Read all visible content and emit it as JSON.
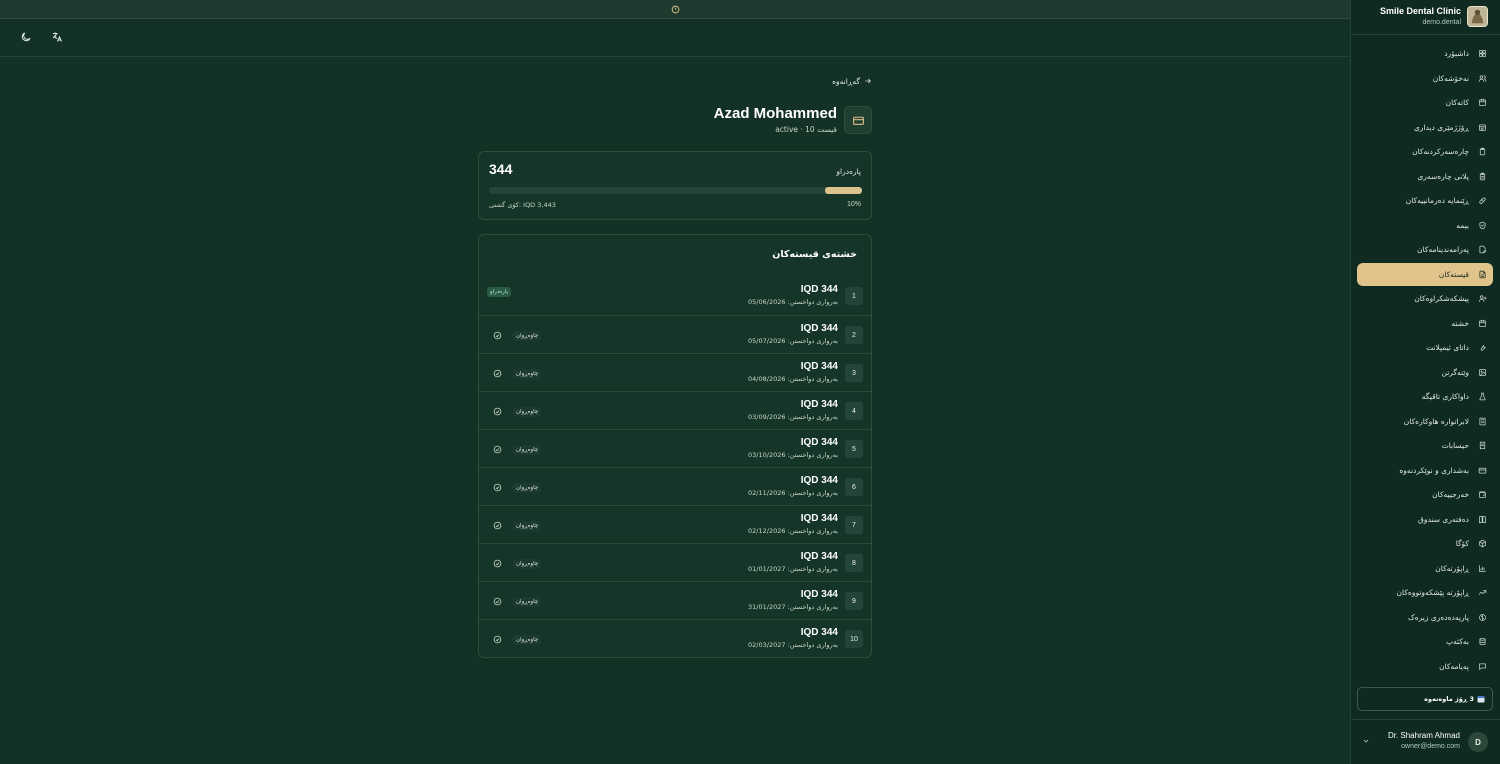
{
  "clinic": {
    "name": "Smile Dental Clinic",
    "domain": "demo.dental"
  },
  "nav": [
    {
      "label": "داشبۆرد",
      "icon": "dashboard-icon",
      "active": false
    },
    {
      "label": "نەخۆشەکان",
      "icon": "users-icon",
      "active": false
    },
    {
      "label": "کاتەکان",
      "icon": "calendar-icon",
      "active": false
    },
    {
      "label": "ڕۆژژمێری دیداری",
      "icon": "calendar-grid-icon",
      "active": false
    },
    {
      "label": "چارەسەرکردنەکان",
      "icon": "clipboard-icon",
      "active": false
    },
    {
      "label": "پلانی چارەسەری",
      "icon": "clipboard-list-icon",
      "active": false
    },
    {
      "label": "ڕێنمایە دەرمانییەکان",
      "icon": "pill-icon",
      "active": false
    },
    {
      "label": "بیمە",
      "icon": "shield-icon",
      "active": false
    },
    {
      "label": "پەزامەندینامەکان",
      "icon": "file-edit-icon",
      "active": false
    },
    {
      "label": "قیستەکان",
      "icon": "file-text-icon",
      "active": true
    },
    {
      "label": "پیشکەشکراوەکان",
      "icon": "user-plus-icon",
      "active": false
    },
    {
      "label": "خشتە",
      "icon": "calendar-icon",
      "active": false
    },
    {
      "label": "داتای ئیمپلانت",
      "icon": "wrench-icon",
      "active": false
    },
    {
      "label": "وێنەگرتن",
      "icon": "image-icon",
      "active": false
    },
    {
      "label": "داواکاری تاقیگە",
      "icon": "flask-icon",
      "active": false
    },
    {
      "label": "لابراتوارە هاوکارەکان",
      "icon": "building-icon",
      "active": false
    },
    {
      "label": "حیسابات",
      "icon": "receipt-icon",
      "active": false
    },
    {
      "label": "بەشداری و نوێکردنەوە",
      "icon": "credit-card-icon",
      "active": false
    },
    {
      "label": "خەرجییەکان",
      "icon": "wallet-icon",
      "active": false
    },
    {
      "label": "دەفتەری سندوق",
      "icon": "book-icon",
      "active": false
    },
    {
      "label": "کۆگا",
      "icon": "box-icon",
      "active": false
    },
    {
      "label": "ڕاپۆرتەکان",
      "icon": "bar-chart-icon",
      "active": false
    },
    {
      "label": "ڕاپۆرتە پێشکەوتووەکان",
      "icon": "trending-up-icon",
      "active": false
    },
    {
      "label": "پاریەدەدەری زیرەک",
      "icon": "brain-icon",
      "active": false
    },
    {
      "label": "بەکئەپ",
      "icon": "database-icon",
      "active": false
    },
    {
      "label": "پەیامەکان",
      "icon": "message-icon",
      "active": false
    }
  ],
  "trial": {
    "text": "3 ڕۆژ ماوەتەوە",
    "icon": "calendar-emoji-icon"
  },
  "user": {
    "initial": "D",
    "name": "Dr. Shahram Ahmad",
    "email": "owner@demo.com"
  },
  "back_label": "گەڕانەوە",
  "patient": {
    "name": "Azad Mohammed",
    "subtitle": "active · 10 قیست"
  },
  "paid": {
    "label": "پارەدراو",
    "amount": "344",
    "total": "کۆی گشتی: IQD 3,443",
    "percent": "10%",
    "progress": 0.1
  },
  "schedule": {
    "title": "خشتەی قیستەکان",
    "rows": [
      {
        "num": "1",
        "amount": "IQD 344",
        "due": "بەرواری دواخستن: 05/06/2026",
        "status": "پارەدراو",
        "paid": true
      },
      {
        "num": "2",
        "amount": "IQD 344",
        "due": "بەرواری دواخستن: 05/07/2026",
        "status": "چاوەڕوان",
        "paid": false
      },
      {
        "num": "3",
        "amount": "IQD 344",
        "due": "بەرواری دواخستن: 04/08/2026",
        "status": "چاوەڕوان",
        "paid": false
      },
      {
        "num": "4",
        "amount": "IQD 344",
        "due": "بەرواری دواخستن: 03/09/2026",
        "status": "چاوەڕوان",
        "paid": false
      },
      {
        "num": "5",
        "amount": "IQD 344",
        "due": "بەرواری دواخستن: 03/10/2026",
        "status": "چاوەڕوان",
        "paid": false
      },
      {
        "num": "6",
        "amount": "IQD 344",
        "due": "بەرواری دواخستن: 02/11/2026",
        "status": "چاوەڕوان",
        "paid": false
      },
      {
        "num": "7",
        "amount": "IQD 344",
        "due": "بەرواری دواخستن: 02/12/2026",
        "status": "چاوەڕوان",
        "paid": false
      },
      {
        "num": "8",
        "amount": "IQD 344",
        "due": "بەرواری دواخستن: 01/01/2027",
        "status": "چاوەڕوان",
        "paid": false
      },
      {
        "num": "9",
        "amount": "IQD 344",
        "due": "بەرواری دواخستن: 31/01/2027",
        "status": "چاوەڕوان",
        "paid": false
      },
      {
        "num": "10",
        "amount": "IQD 344",
        "due": "بەرواری دواخستن: 02/03/2027",
        "status": "چاوەڕوان",
        "paid": false
      }
    ]
  },
  "toolbar": {
    "theme_icon": "moon-icon",
    "language_icon": "translate-icon",
    "banner_icon": "alert-icon"
  },
  "colors": {
    "background": "#143126",
    "sidebar": "#0f2a20",
    "accent": "#e0c48b",
    "card": "#163529",
    "paid_badge": "#285a45"
  }
}
